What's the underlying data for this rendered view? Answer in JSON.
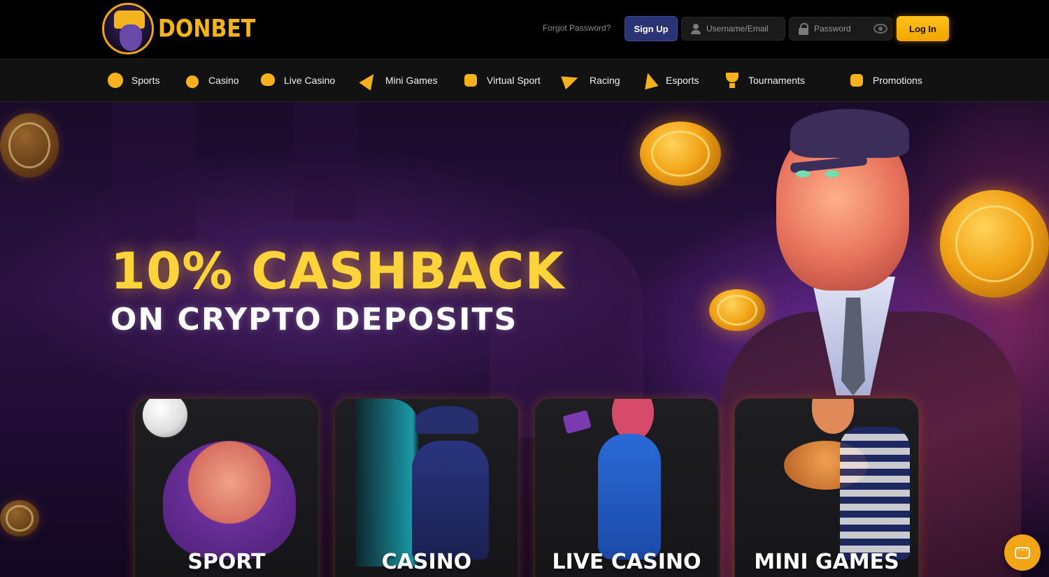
{
  "brand": {
    "name": "DONBET"
  },
  "auth": {
    "forgot_label": "Forgot Password?",
    "signup_label": "Sign Up",
    "username_placeholder": "Username/Email",
    "password_placeholder": "Password",
    "login_label": "Log In"
  },
  "nav": {
    "items": [
      {
        "label": "Sports",
        "icon": "basketball-icon"
      },
      {
        "label": "Casino",
        "icon": "cherry-icon"
      },
      {
        "label": "Live Casino",
        "icon": "spade-icon"
      },
      {
        "label": "Mini Games",
        "icon": "rocket-icon"
      },
      {
        "label": "Virtual Sport",
        "icon": "gamepad-icon"
      },
      {
        "label": "Racing",
        "icon": "horse-icon"
      },
      {
        "label": "Esports",
        "icon": "soldier-icon"
      },
      {
        "label": "Tournaments",
        "icon": "trophy-icon",
        "hot": true
      },
      {
        "label": "Promotions",
        "icon": "gift-icon",
        "hot": true
      }
    ]
  },
  "hero": {
    "headline": "10% CASHBACK",
    "subheadline": "ON CRYPTO DEPOSITS"
  },
  "categories": [
    {
      "label": "SPORT"
    },
    {
      "label": "CASINO"
    },
    {
      "label": "LIVE CASINO"
    },
    {
      "label": "MINI GAMES"
    }
  ],
  "colors": {
    "accent": "#f5b21c",
    "signup": "#2a3475",
    "background": "#000000"
  }
}
